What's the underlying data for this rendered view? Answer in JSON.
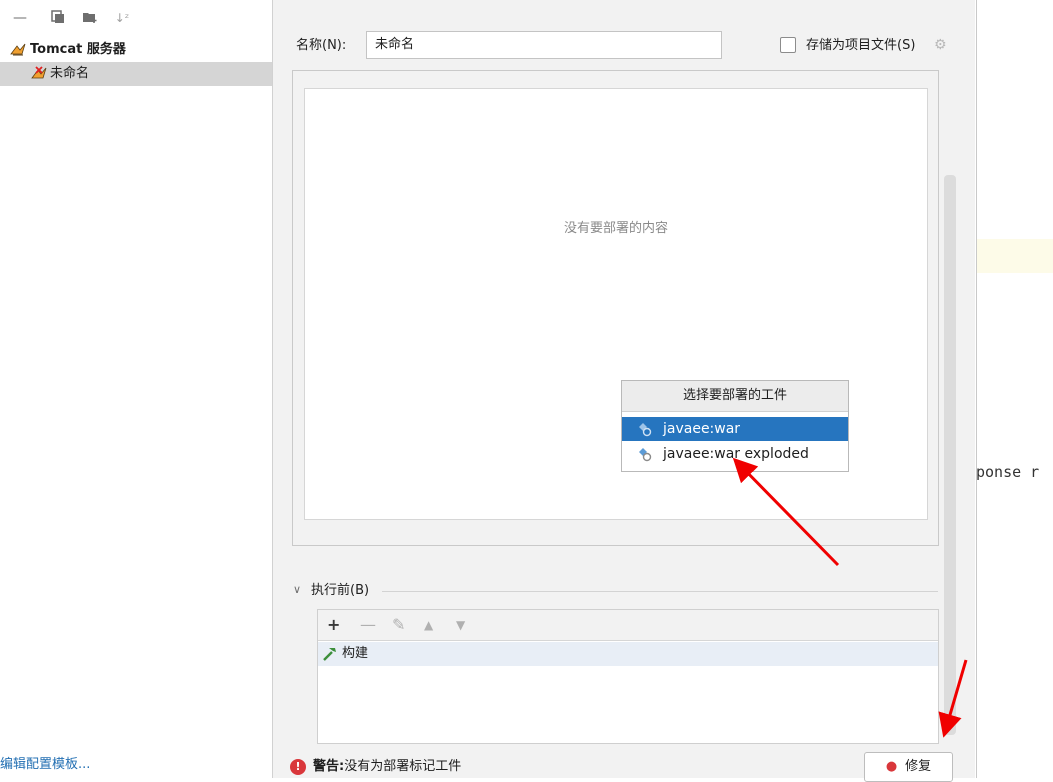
{
  "left_panel": {
    "toolbar_icons": [
      "remove-icon",
      "copy-icon",
      "new-folder-icon",
      "sort-icon"
    ],
    "tree": {
      "group_label": "Tomcat 服务器",
      "child_label": "未命名"
    },
    "edit_templates_link": "编辑配置模板..."
  },
  "form": {
    "name_label": "名称(N):",
    "name_value": "未命名",
    "store_as_project_label": "存储为项目文件(S)",
    "store_as_project_checked": false
  },
  "deployment": {
    "empty_text": "没有要部署的内容"
  },
  "popup": {
    "title": "选择要部署的工件",
    "items": [
      {
        "label": "javaee:war",
        "selected": true
      },
      {
        "label": "javaee:war exploded",
        "selected": false
      }
    ]
  },
  "before_launch": {
    "label": "执行前(B)",
    "toolbar": [
      "add-icon",
      "remove-icon",
      "edit-icon",
      "move-up-icon",
      "move-down-icon"
    ],
    "tasks": [
      {
        "label": "构建"
      }
    ]
  },
  "footer": {
    "warning_prefix": "警告:",
    "warning_text": "没有为部署标记工件",
    "fix_button": "修复"
  },
  "background_editor": {
    "code_fragment": "ponse r"
  },
  "colors": {
    "selection": "#2675bf",
    "link": "#2470b3",
    "warning": "#d9373b",
    "arrow": "#f00000"
  }
}
